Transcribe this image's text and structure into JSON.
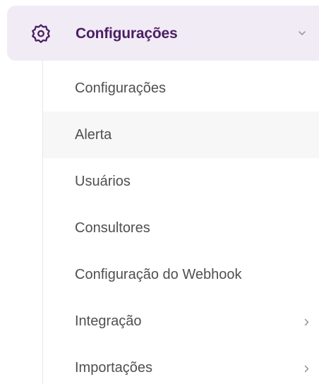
{
  "menu": {
    "parent": {
      "label": "Configurações",
      "icon": "gear-icon",
      "chevron_icon": "chevron-down-icon",
      "expanded": true
    },
    "submenu": [
      {
        "label": "Configurações",
        "active": false
      },
      {
        "label": "Alerta",
        "active": true
      },
      {
        "label": "Usuários",
        "active": false
      },
      {
        "label": "Consultores",
        "active": false
      },
      {
        "label": "Configuração do Webhook",
        "active": false
      },
      {
        "label": "Integração",
        "active": false,
        "has_children": true,
        "chevron_icon": "chevron-right-icon"
      },
      {
        "label": "Importações",
        "active": false,
        "has_children": true,
        "chevron_icon": "chevron-right-icon"
      }
    ]
  },
  "colors": {
    "accent": "#4b1e63",
    "parent_background": "#f1ebf5",
    "active_background": "#f7f7f8",
    "text": "#4f4f4f"
  }
}
